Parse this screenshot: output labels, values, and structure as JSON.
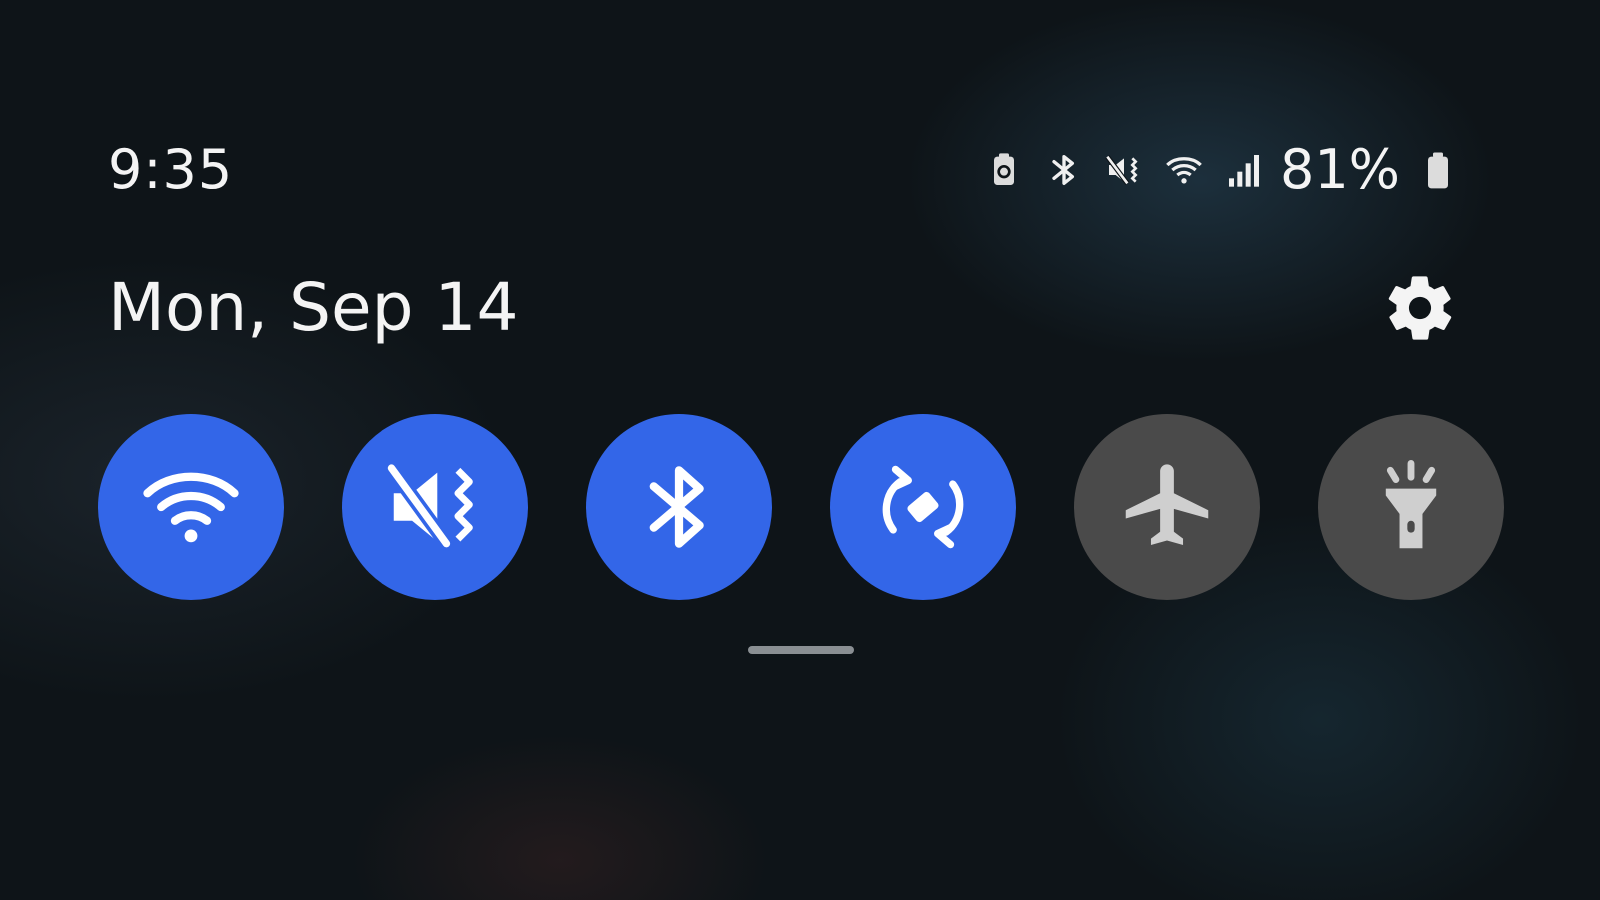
{
  "status_bar": {
    "time": "9:35",
    "battery_percent": "81%",
    "icons": [
      "battery-saver-icon",
      "bluetooth-icon",
      "vibrate-icon",
      "wifi-icon",
      "signal-icon",
      "battery-icon"
    ]
  },
  "header": {
    "date": "Mon, Sep 14",
    "settings_icon": "gear-icon"
  },
  "quick_settings": {
    "tiles": [
      {
        "name": "wifi",
        "icon": "wifi-icon",
        "state": "on"
      },
      {
        "name": "vibrate",
        "icon": "vibrate-icon",
        "state": "on"
      },
      {
        "name": "bluetooth",
        "icon": "bluetooth-icon",
        "state": "on"
      },
      {
        "name": "auto-rotate",
        "icon": "auto-rotate-icon",
        "state": "on"
      },
      {
        "name": "airplane-mode",
        "icon": "airplane-icon",
        "state": "off"
      },
      {
        "name": "flashlight",
        "icon": "flashlight-icon",
        "state": "off"
      }
    ]
  },
  "colors": {
    "tile_active": "#3366e8",
    "tile_inactive": "#4a4a4a",
    "background": "#0e1418",
    "text": "#f4f4f4"
  }
}
